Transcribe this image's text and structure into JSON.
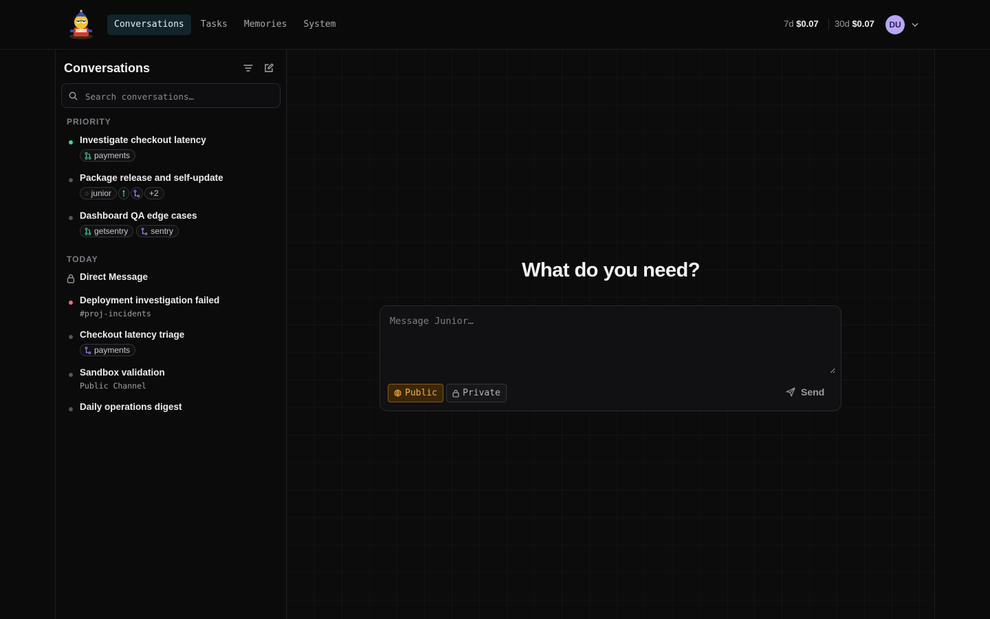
{
  "nav": {
    "items": [
      {
        "label": "Conversations",
        "active": true
      },
      {
        "label": "Tasks",
        "active": false
      },
      {
        "label": "Memories",
        "active": false
      },
      {
        "label": "System",
        "active": false
      }
    ]
  },
  "costs": {
    "week_label": "7d",
    "week_value": "$0.07",
    "month_label": "30d",
    "month_value": "$0.07"
  },
  "user": {
    "initials": "DU"
  },
  "sidebar": {
    "title": "Conversations",
    "search_placeholder": "Search conversations…",
    "sections": [
      {
        "label": "PRIORITY"
      },
      {
        "label": "TODAY"
      }
    ],
    "priority": [
      {
        "title": "Investigate checkout latency",
        "status": "green",
        "tags": [
          "payments"
        ]
      },
      {
        "title": "Package release and self-update",
        "status": "gray",
        "tags": [
          "junior"
        ],
        "more": "+2"
      },
      {
        "title": "Dashboard QA edge cases",
        "status": "gray",
        "tags": [
          "getsentry",
          "sentry"
        ]
      }
    ],
    "today": [
      {
        "title": "Direct Message",
        "status": "lock"
      },
      {
        "title": "Deployment investigation failed",
        "status": "red",
        "sub": "#proj-incidents"
      },
      {
        "title": "Checkout latency triage",
        "status": "gray",
        "tags": [
          "payments"
        ]
      },
      {
        "title": "Sandbox validation",
        "status": "gray",
        "sub": "Public Channel"
      },
      {
        "title": "Daily operations digest",
        "status": "gray"
      }
    ]
  },
  "composer": {
    "headline": "What do you need?",
    "placeholder": "Message Junior…",
    "public_label": "Public",
    "private_label": "Private",
    "send_label": "Send"
  },
  "colors": {
    "accent_active_nav": "#13242a",
    "public_amber": "#f4b23a",
    "status_green": "#3fd69a",
    "status_red": "#f06a7e",
    "avatar": "#b9a6f4"
  }
}
